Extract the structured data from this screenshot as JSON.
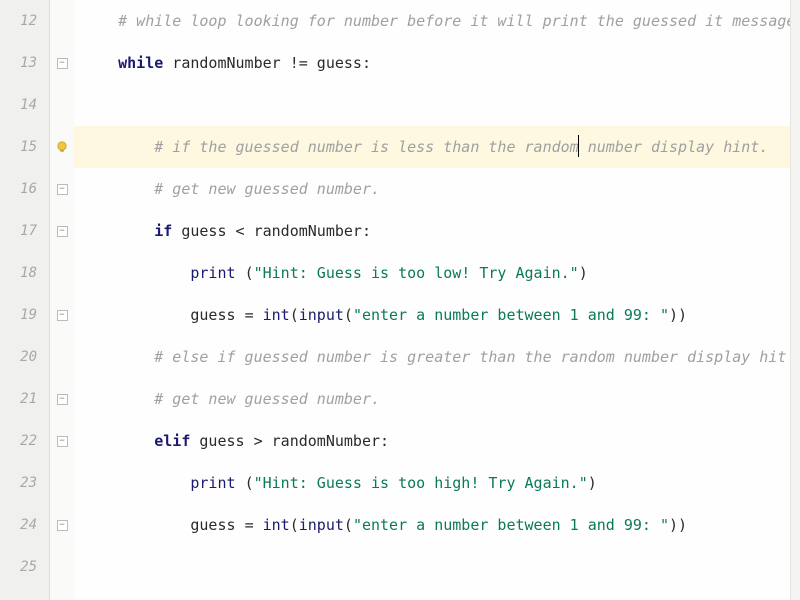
{
  "gutter": {
    "lines": [
      "12",
      "13",
      "14",
      "15",
      "16",
      "17",
      "18",
      "19",
      "20",
      "21",
      "22",
      "23",
      "24",
      "25"
    ]
  },
  "code": {
    "l12": "# while loop looking for number before it will print the guessed it message",
    "l13_kw": "while",
    "l13_lhs": " randomNumber ",
    "l13_op": "!=",
    "l13_rhs": " guess",
    "l13_colon": ":",
    "l15_a": "# if the guessed number is less than the random",
    "l15_b": " number display hint.",
    "l16": "# get new guessed number.",
    "l17_kw": "if",
    "l17_lhs": " guess ",
    "l17_op": "<",
    "l17_rhs": " randomNumber",
    "l17_colon": ":",
    "l18_fn": "print",
    "l18_sp": " ",
    "l18_lp": "(",
    "l18_str": "\"Hint: Guess is too low! Try Again.\"",
    "l18_rp": ")",
    "l19_var": "guess ",
    "l19_eq": "=",
    "l19_sp": " ",
    "l19_int": "int",
    "l19_lp1": "(",
    "l19_input": "input",
    "l19_lp2": "(",
    "l19_str": "\"enter a number between 1 and 99: \"",
    "l19_rp": "))",
    "l20": "# else if guessed number is greater than the random number display hit",
    "l21": "# get new guessed number.",
    "l22_kw": "elif",
    "l22_lhs": " guess ",
    "l22_op": ">",
    "l22_rhs": " randomNumber",
    "l22_colon": ":",
    "l23_fn": "print",
    "l23_sp": " ",
    "l23_lp": "(",
    "l23_str": "\"Hint: Guess is too high! Try Again.\"",
    "l23_rp": ")",
    "l24_var": "guess ",
    "l24_eq": "=",
    "l24_sp": " ",
    "l24_int": "int",
    "l24_lp1": "(",
    "l24_input": "input",
    "l24_lp2": "(",
    "l24_str": "\"enter a number between 1 and 99: \"",
    "l24_rp": "))"
  },
  "indents": {
    "one": "    ",
    "two": "        ",
    "three": "            "
  }
}
